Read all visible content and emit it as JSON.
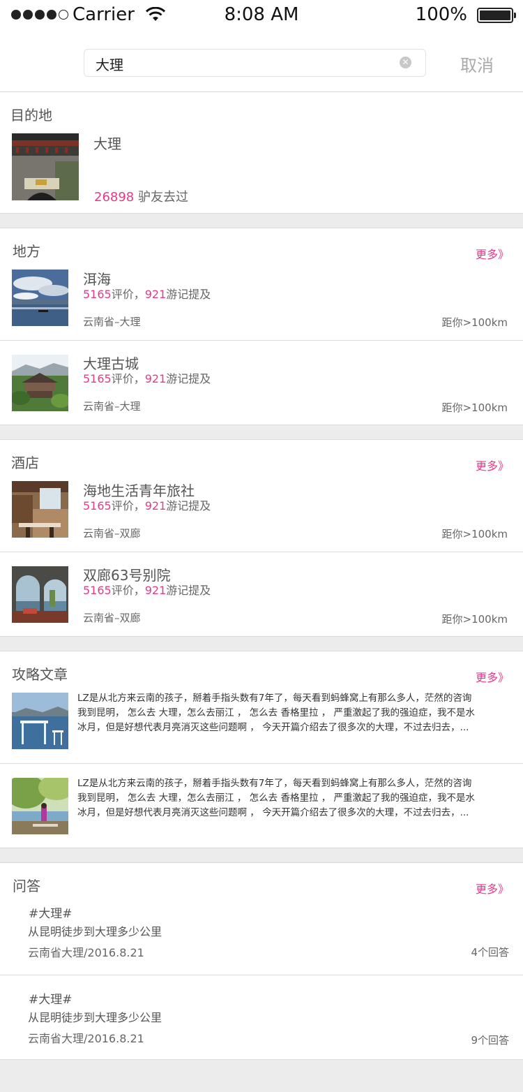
{
  "status_bar": {
    "carrier": "Carrier",
    "time": "8:08 AM",
    "battery": "100%",
    "signal_bars": 4
  },
  "search": {
    "value": "大理",
    "cancel_label": "取消"
  },
  "destination": {
    "title": "目的地",
    "name": "大理",
    "visitors_count": "26898",
    "visitors_suffix": " 驴友去过"
  },
  "places": {
    "title": "地方",
    "more_label": "更多》",
    "items": [
      {
        "name": "洱海",
        "reviews": "5165",
        "reviews_suffix": "评价，",
        "mentions": "921",
        "mentions_suffix": "游记提及",
        "location": "云南省–大理",
        "distance": "距你>100km"
      },
      {
        "name": "大理古城",
        "reviews": "5165",
        "reviews_suffix": "评价，",
        "mentions": "921",
        "mentions_suffix": "游记提及",
        "location": "云南省–大理",
        "distance": "距你>100km"
      }
    ]
  },
  "hotels": {
    "title": "酒店",
    "more_label": "更多》",
    "items": [
      {
        "name": "海地生活青年旅社",
        "reviews": "5165",
        "reviews_suffix": "评价，",
        "mentions": "921",
        "mentions_suffix": "游记提及",
        "location": "云南省–双廊",
        "distance": "距你>100km"
      },
      {
        "name": "双廊63号别院",
        "reviews": "5165",
        "reviews_suffix": "评价，",
        "mentions": "921",
        "mentions_suffix": "游记提及",
        "location": "云南省–双廊",
        "distance": "距你>100km"
      }
    ]
  },
  "articles": {
    "title": "攻略文章",
    "more_label": "更多》",
    "items": [
      {
        "line1": "LZ是从北方来云南的孩子，掰着手指头数有7年了，每天看到蚂蜂窝上有那么多人，茫然的咨询",
        "line2": "我到昆明， 怎么去 大理，怎么去丽江 ， 怎么去 香格里拉 ， 严重激起了我的强迫症，我不是水",
        "line3": "冰月，但是好想代表月亮消灭这些问题啊 ， 今天开篇介绍去了很多次的大理，不过去归去，..."
      },
      {
        "line1": "LZ是从北方来云南的孩子，掰着手指头数有7年了，每天看到蚂蜂窝上有那么多人，茫然的咨询",
        "line2": "我到昆明， 怎么去 大理，怎么去丽江 ， 怎么去 香格里拉 ， 严重激起了我的强迫症，我不是水",
        "line3": "冰月，但是好想代表月亮消灭这些问题啊 ， 今天开篇介绍去了很多次的大理，不过去归去，..."
      }
    ]
  },
  "qa": {
    "title": "问答",
    "more_label": "更多》",
    "items": [
      {
        "tag": "#大理#",
        "question": "从昆明徒步到大理多少公里",
        "meta": "云南省大理/2016.8.21",
        "answers": "4个回答"
      },
      {
        "tag": "#大理#",
        "question": "从昆明徒步到大理多少公里",
        "meta": "云南省大理/2016.8.21",
        "answers": "9个回答"
      }
    ]
  },
  "colors": {
    "accent": "#e6398a",
    "background": "#ececec",
    "text": "#555555"
  }
}
